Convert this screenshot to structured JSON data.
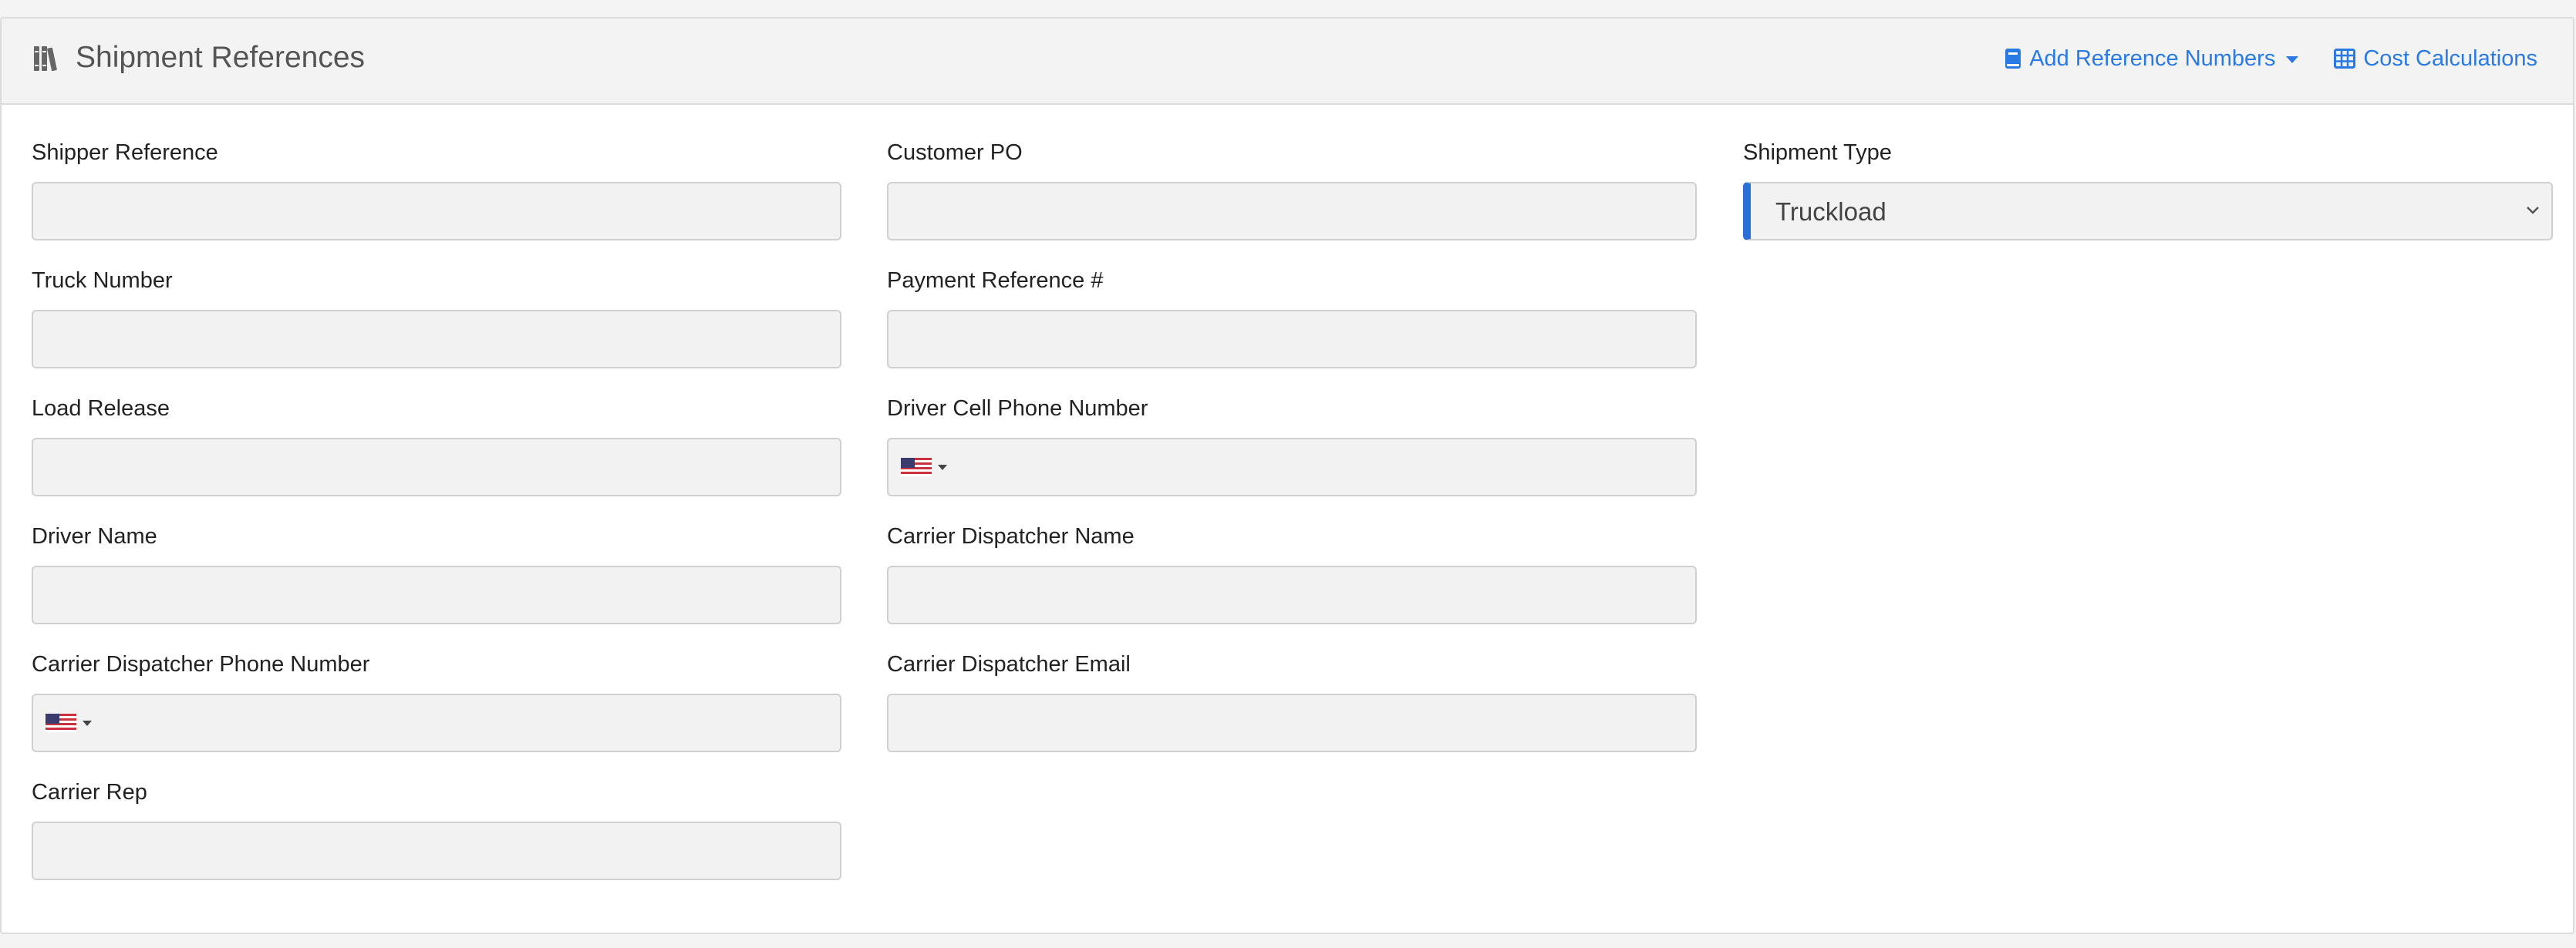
{
  "header": {
    "title": "Shipment References",
    "icon": "books-icon",
    "actions": [
      {
        "label": "Add Reference Numbers",
        "icon": "book-icon",
        "dropdown": true
      },
      {
        "label": "Cost Calculations",
        "icon": "table-icon"
      }
    ]
  },
  "form": {
    "shipper_reference": {
      "label": "Shipper Reference",
      "value": ""
    },
    "truck_number": {
      "label": "Truck Number",
      "value": ""
    },
    "load_release": {
      "label": "Load Release",
      "value": ""
    },
    "driver_name": {
      "label": "Driver Name",
      "value": ""
    },
    "carrier_dispatcher_phone": {
      "label": "Carrier Dispatcher Phone Number",
      "value": "",
      "country": "US"
    },
    "carrier_rep": {
      "label": "Carrier Rep",
      "value": ""
    },
    "customer_po": {
      "label": "Customer PO",
      "value": ""
    },
    "payment_reference": {
      "label": "Payment Reference #",
      "value": ""
    },
    "driver_cell_phone": {
      "label": "Driver Cell Phone Number",
      "value": "",
      "country": "US"
    },
    "carrier_dispatcher_name": {
      "label": "Carrier Dispatcher Name",
      "value": ""
    },
    "carrier_dispatcher_email": {
      "label": "Carrier Dispatcher Email",
      "value": ""
    },
    "shipment_type": {
      "label": "Shipment Type",
      "value": "Truckload"
    }
  },
  "colors": {
    "accent": "#2a7ae4",
    "select_highlight": "#2a6fd6",
    "input_bg": "#f2f2f2",
    "header_bg": "#f3f3f3"
  }
}
